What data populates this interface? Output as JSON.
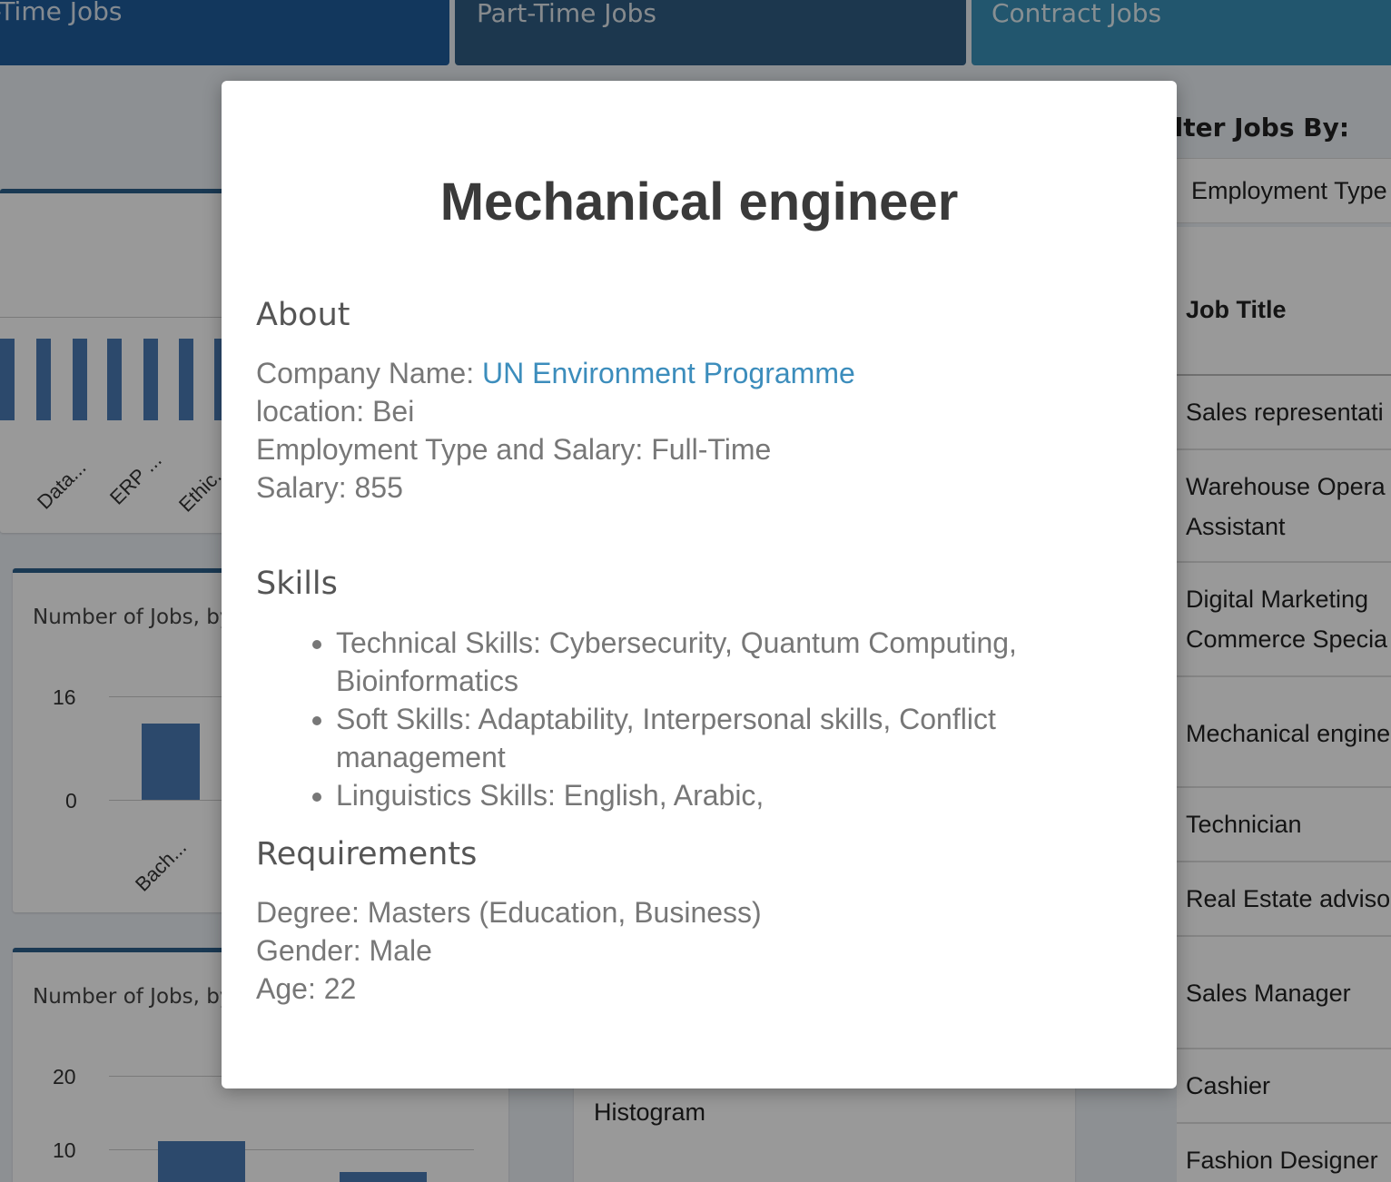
{
  "tabs": {
    "full_time": "l-Time Jobs",
    "part_time": "Part-Time Jobs",
    "contract": "Contract Jobs"
  },
  "background_charts": {
    "top_labels": [
      "Data...",
      "ERP ...",
      "Ethic..."
    ],
    "mid_title": "Number of Jobs, by",
    "mid_ticks": [
      "16",
      "0"
    ],
    "mid_label": "Bach...",
    "bot_title": "Number of Jobs, by",
    "bot_ticks": [
      "20",
      "10"
    ],
    "histogram_title": "Histogram",
    "accent_color": "#4a7bb5"
  },
  "filter_panel": {
    "heading": "ilter Jobs By:",
    "filter_value": "Employment Type",
    "table_header": "Job Title",
    "rows": [
      [
        "Sales representati"
      ],
      [
        "Warehouse Opera",
        "Assistant"
      ],
      [
        "Digital Marketing",
        "Commerce Specia"
      ],
      [
        "Mechanical engine"
      ],
      [
        "Technician"
      ],
      [
        "Real Estate adviso"
      ],
      [
        "Sales Manager"
      ],
      [
        "Cashier"
      ],
      [
        "Fashion Designer"
      ]
    ]
  },
  "modal": {
    "title": "Mechanical engineer",
    "about_heading": "About",
    "company_label": "Company Name: ",
    "company_name": "UN Environment Programme",
    "location": "location: Bei",
    "employment": "Employment Type and Salary: Full-Time",
    "salary": "Salary: 855",
    "skills_heading": "Skills",
    "skills": [
      "Technical Skills: Cybersecurity, Quantum Computing, Bioinformatics",
      "Soft Skills: Adaptability, Interpersonal skills, Conflict management",
      "Linguistics Skills: English, Arabic,"
    ],
    "requirements_heading": "Requirements",
    "degree": "Degree: Masters (Education, Business)",
    "gender": "Gender: Male",
    "age": "Age: 22",
    "link_color": "#3c8dbc"
  }
}
